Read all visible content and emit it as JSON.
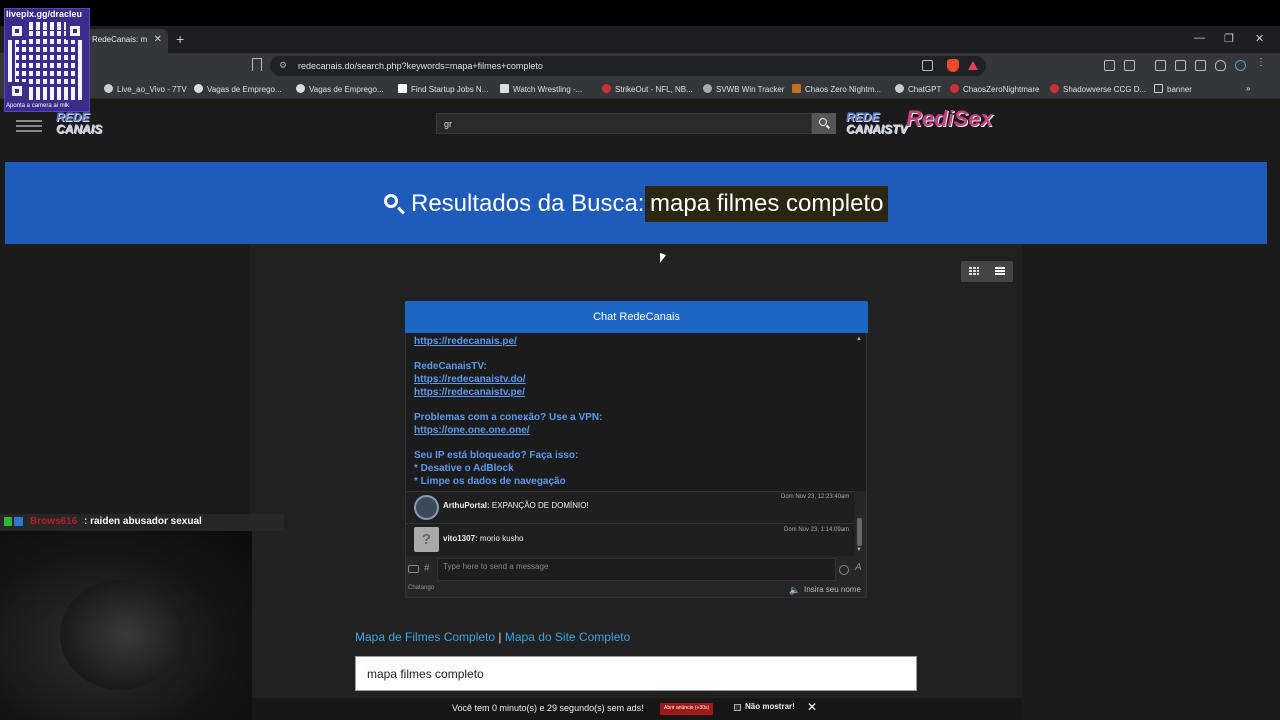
{
  "browser": {
    "tab_title": "RedeCanais: m",
    "url": "redecanais.do/search.php?keywords=mapa+filmes+completo",
    "bookmarks": [
      "Live_ao_Vivo - 7TV",
      "Vagas de Emprego...",
      "Vagas de Emprego...",
      "Find Startup Jobs N...",
      "Watch Wrestling -...",
      "StrikeOut - NFL, NB...",
      "SVWB Win Tracker",
      "Chaos Zero Nightm...",
      "ChatGPT",
      "ChaosZeroNightmare",
      "Shadowverse CCG D...",
      "banner"
    ]
  },
  "header": {
    "logo_left_line1": "REDE",
    "logo_left_line2": "CANAIS",
    "search_value": "gr",
    "logo_right_line1": "REDE",
    "logo_right_line2": "CANAISTV",
    "logo_right_overlay": "RediSex"
  },
  "banner": {
    "title": "Resultados da Busca:",
    "term": "mapa filmes completo"
  },
  "chat": {
    "title": "Chat RedeCanais",
    "lines": [
      {
        "text": "https://redecanais.pe/",
        "link": true
      },
      {
        "text": "RedeCanaisTV:",
        "link": false
      },
      {
        "text": "https://redecanaistv.do/",
        "link": true
      },
      {
        "text": "https://redecanaistv.pe/",
        "link": true
      },
      {
        "text": "Problemas com a conexão? Use a VPN:",
        "link": false
      },
      {
        "text": "https://one.one.one.one/",
        "link": true
      },
      {
        "text": "Seu IP está bloqueado? Faça isso:",
        "link": false
      },
      {
        "text": "* Desative o AdBlock",
        "link": false
      },
      {
        "text": "* Limpe os dados de navegação",
        "link": false
      }
    ],
    "posts": [
      {
        "user": "ArthuPortal:",
        "message": "EXPANÇÃO DE DOMÍNIO!",
        "time": "Dom Nov 23, 12:23:40am"
      },
      {
        "user": "vito1307:",
        "message": "morio kusho",
        "time": "Dom Nov 23, 1:14:09am"
      }
    ],
    "input_placeholder": "Type here to send a message",
    "brand": "Chatango",
    "name_prompt": "Insira seu nome"
  },
  "links": {
    "movies_map": "Mapa de Filmes Completo",
    "separator": "|",
    "site_map": "Mapa do Site Completo"
  },
  "result_box": "mapa filmes completo",
  "adbar": {
    "text": "Você tem 0 minuto(s) e 29 segundo(s) sem ads!",
    "open_ad": "Abrir anúncio (+30s)",
    "dont_show": "Não mostrar!",
    "close": "✕"
  },
  "stream_overlay": {
    "qr_title": "livepix.gg/dracleu",
    "qr_caption": "Aponta a camera ai mlk",
    "chat_user": "Brows616",
    "chat_message": ": raiden abusador sexual"
  },
  "colors": {
    "banner_blue": "#1f5bb9",
    "chat_header_blue": "#1d66c4",
    "link_blue": "#3ba5e6",
    "ad_button_red": "#a01818"
  }
}
